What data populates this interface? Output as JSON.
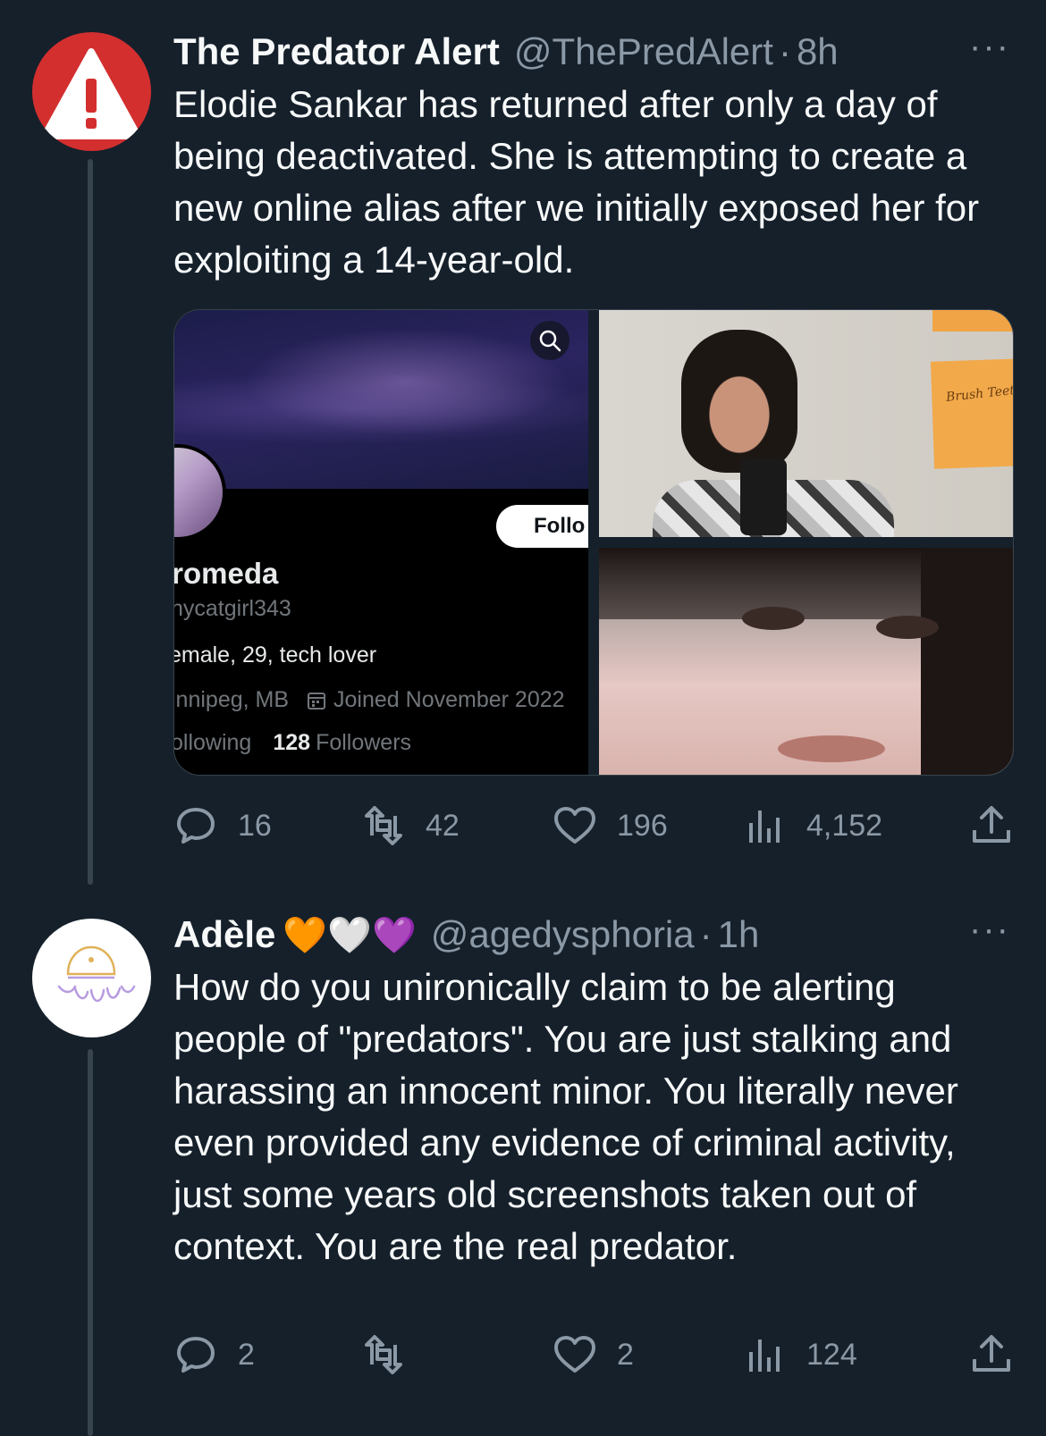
{
  "tweet1": {
    "display_name": "The Predator Alert",
    "handle": "@ThePredAlert",
    "separator": "·",
    "time": "8h",
    "more": "···",
    "text": "Elodie Sankar has returned after only a day of being deactivated. She is attempting to create a new online alias after we initially exposed her for exploiting a 14-year-old.",
    "avatar_icon": "warning-triangle-icon",
    "media": {
      "profile_screenshot": {
        "follow_label": "Follo",
        "name": "lromeda",
        "handle": "hycatgirl343",
        "bio": "emale, 29, tech lover",
        "location": "innipeg, MB",
        "joined": "Joined November 2022",
        "following_label": "ollowing",
        "followers_count": "128",
        "followers_label": "Followers"
      },
      "note_text": "Brush Teet"
    },
    "actions": {
      "replies": "16",
      "retweets": "42",
      "likes": "196",
      "views": "4,152"
    }
  },
  "tweet2": {
    "display_name": "Adèle",
    "emojis": "🧡🤍💜",
    "handle": "@agedysphoria",
    "separator": "·",
    "time": "1h",
    "more": "···",
    "text": "How do you unironically claim to be alerting people of \"predators\". You are just stalking and harassing an innocent minor. You literally never even provided any evidence of criminal activity, just some years old screenshots taken out of context. You are the real predator.",
    "avatar_icon": "jellyfish-icon",
    "actions": {
      "replies": "2",
      "retweets": "",
      "likes": "2",
      "views": "124"
    }
  },
  "colors": {
    "background": "#15202b",
    "text": "#f7f9f9",
    "secondary": "#8b98a5",
    "alert_red": "#d32f2f"
  }
}
